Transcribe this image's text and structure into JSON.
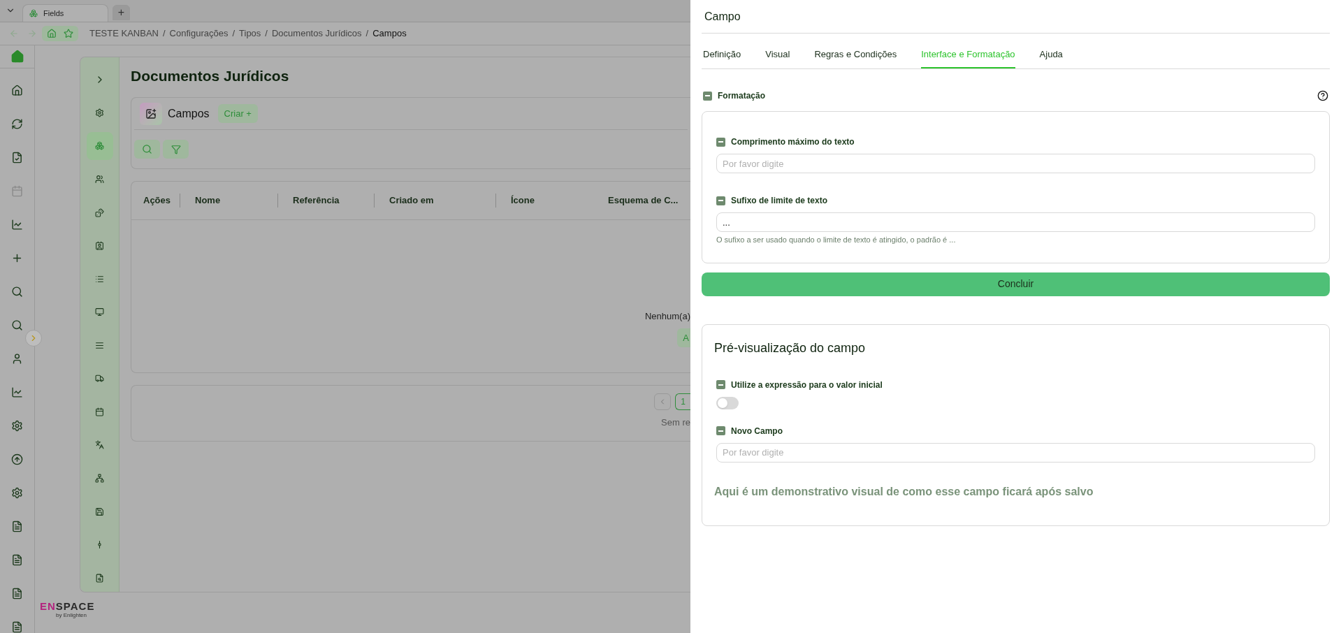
{
  "browser": {
    "tabs": [
      {
        "label": "Fields",
        "selected": true
      }
    ],
    "new_tab": "+",
    "breadcrumb_separator": "/",
    "breadcrumb": [
      "TESTE KANBAN",
      "Configurações",
      "Tipos",
      "Documentos Jurídicos",
      "Campos"
    ]
  },
  "side_nav": [
    {
      "selected": false
    },
    {
      "selected": false
    },
    {
      "selected": true
    },
    {
      "selected": false
    },
    {
      "selected": false
    },
    {
      "selected": false
    },
    {
      "selected": false
    },
    {
      "selected": false
    },
    {
      "selected": false
    },
    {
      "selected": false
    },
    {
      "selected": false
    },
    {
      "selected": false
    },
    {
      "selected": false
    },
    {
      "selected": false
    },
    {
      "selected": false
    },
    {
      "selected": false
    }
  ],
  "page": {
    "title": "Documentos Jurídicos",
    "section": "Campos",
    "create_button": "Criar +",
    "table": {
      "columns": [
        "Ações",
        "Nome",
        "Referência",
        "Criado em",
        "Ícone",
        "Esquema de C..."
      ],
      "empty_message": "Nenhum(a)",
      "empty_action": "A"
    },
    "pagination": {
      "pages": [
        {
          "label": "1",
          "selected": true
        }
      ],
      "summary": "Sem re"
    }
  },
  "logo": {
    "parts": [
      {
        "text": "EN",
        "color": "#b4237f"
      },
      {
        "text": "SPACE",
        "color": "#2b2b2b"
      }
    ],
    "byline": "by Enlighten"
  },
  "drawer": {
    "title": "Campo",
    "tabs": [
      {
        "label": "Definição",
        "selected": false
      },
      {
        "label": "Visual",
        "selected": false
      },
      {
        "label": "Regras e Condições",
        "selected": false
      },
      {
        "label": "Interface e Formatação",
        "selected": true
      },
      {
        "label": "Ajuda",
        "selected": false
      }
    ],
    "section": {
      "title": "Formatação",
      "fields": [
        {
          "kind": "text",
          "label": "Comprimento máximo do texto",
          "placeholder": "Por favor digite"
        },
        {
          "kind": "text",
          "label": "Sufixo de limite de texto",
          "value": "...",
          "help": "O sufixo a ser usado quando o limite de texto é atingido, o padrão é ..."
        }
      ]
    },
    "submit": "Concluir",
    "preview": {
      "title": "Pré-visualização do campo",
      "fields": [
        {
          "kind": "switch",
          "label": "Utilize a expressão para o valor inicial",
          "on": false
        },
        {
          "kind": "text",
          "label": "Novo Campo",
          "placeholder": "Por favor digite"
        }
      ],
      "note": "Aqui é um demonstrativo visual de como esse campo ficará após salvo"
    }
  }
}
